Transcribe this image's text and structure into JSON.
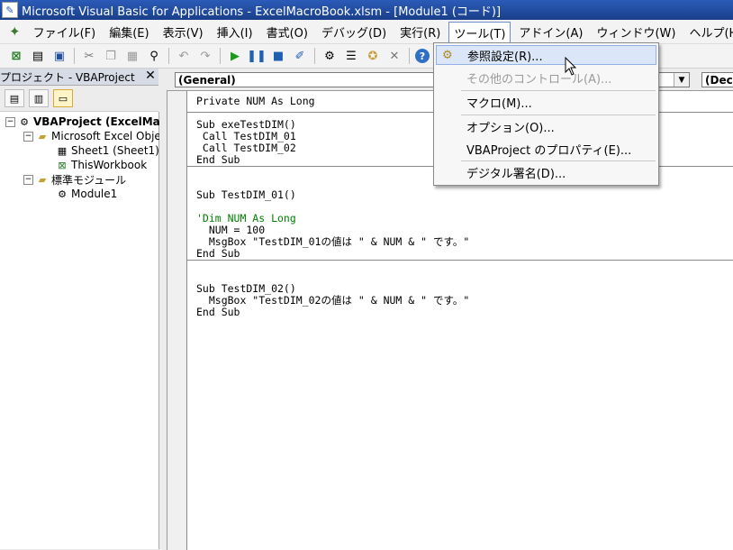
{
  "window": {
    "title": "Microsoft Visual Basic for Applications - ExcelMacroBook.xlsm - [Module1 (コード)]"
  },
  "menubar": {
    "items": [
      "ファイル(F)",
      "編集(E)",
      "表示(V)",
      "挿入(I)",
      "書式(O)",
      "デバッグ(D)",
      "実行(R)",
      "ツール(T)",
      "アドイン(A)",
      "ウィンドウ(W)",
      "ヘルプ(H)"
    ]
  },
  "project": {
    "title": "プロジェクト - VBAProject",
    "close": "✕",
    "tree": {
      "root": "VBAProject (ExcelMac",
      "excel_objects": "Microsoft Excel Objec",
      "sheet1": "Sheet1 (Sheet1)",
      "workbook": "ThisWorkbook",
      "modules": "標準モジュール",
      "module1": "Module1"
    }
  },
  "combos": {
    "object": "(General)",
    "procedure": "(Decl"
  },
  "code": {
    "block1": "Private NUM As Long",
    "block2": "Sub exeTestDIM()\n Call TestDIM_01\n Call TestDIM_02\nEnd Sub",
    "block3_a": "Sub TestDIM_01()",
    "block3_comment": "'Dim NUM As Long",
    "block3_b": "  NUM = 100\n  MsgBox \"TestDIM_01の値は \" & NUM & \" です。\"\nEnd Sub",
    "block4": "Sub TestDIM_02()\n  MsgBox \"TestDIM_02の値は \" & NUM & \" です。\"\nEnd Sub"
  },
  "tools_menu": {
    "references": "参照設定(R)...",
    "other_controls": "その他のコントロール(A)...",
    "macros": "マクロ(M)...",
    "options": "オプション(O)...",
    "project_properties": "VBAProject のプロパティ(E)...",
    "digital_signature": "デジタル署名(D)..."
  }
}
